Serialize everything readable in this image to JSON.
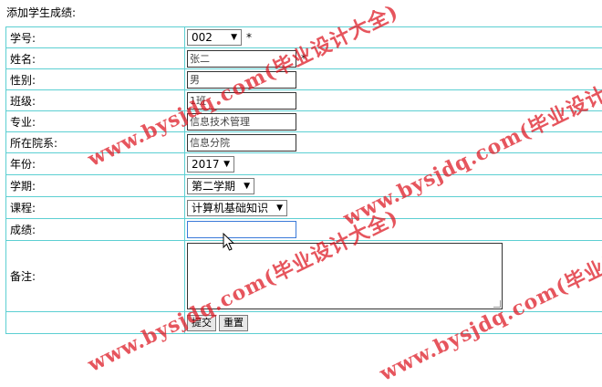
{
  "page_title": "添加学生成绩:",
  "fields": {
    "student_id": {
      "label": "学号:",
      "value": "002",
      "required_mark": "*"
    },
    "name": {
      "label": "姓名:",
      "value": "张二",
      "required_mark": "*"
    },
    "gender": {
      "label": "性别:",
      "value": "男"
    },
    "class": {
      "label": "班级:",
      "value": "1班"
    },
    "major": {
      "label": "专业:",
      "value": "信息技术管理"
    },
    "department": {
      "label": "所在院系:",
      "value": "信息分院"
    },
    "year": {
      "label": "年份:",
      "value": "2017"
    },
    "semester": {
      "label": "学期:",
      "value": "第二学期"
    },
    "course": {
      "label": "课程:",
      "value": "计算机基础知识"
    },
    "score": {
      "label": "成绩:",
      "value": ""
    },
    "remarks": {
      "label": "备注:",
      "value": ""
    }
  },
  "buttons": {
    "submit": "提交",
    "reset": "重置"
  },
  "watermark": {
    "text": "www.bysjdq.com(毕业设计大全)",
    "color": "#dc141e"
  }
}
